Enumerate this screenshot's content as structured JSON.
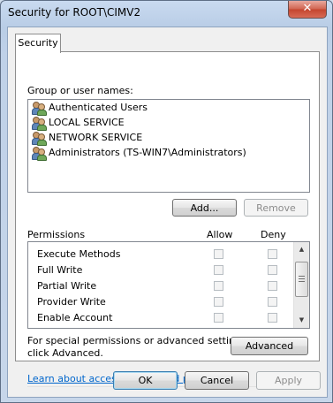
{
  "window": {
    "title": "Security for ROOT\\CIMV2",
    "close_glyph": "✕"
  },
  "tabs": [
    {
      "label": "Security"
    }
  ],
  "group_section": {
    "label": "Group or user names:"
  },
  "users": [
    {
      "name": "Authenticated Users",
      "icon": "user-group-icon"
    },
    {
      "name": "LOCAL SERVICE",
      "icon": "user-group-icon"
    },
    {
      "name": "NETWORK SERVICE",
      "icon": "user-group-icon"
    },
    {
      "name": "Administrators (TS-WIN7\\Administrators)",
      "icon": "user-group-icon"
    }
  ],
  "buttons": {
    "add": "Add...",
    "remove": "Remove",
    "advanced": "Advanced",
    "ok": "OK",
    "cancel": "Cancel",
    "apply": "Apply"
  },
  "permissions": {
    "header": "Permissions",
    "allow_header": "Allow",
    "deny_header": "Deny",
    "items": [
      {
        "name": "Execute Methods",
        "allow": false,
        "deny": false
      },
      {
        "name": "Full Write",
        "allow": false,
        "deny": false
      },
      {
        "name": "Partial Write",
        "allow": false,
        "deny": false
      },
      {
        "name": "Provider Write",
        "allow": false,
        "deny": false
      },
      {
        "name": "Enable Account",
        "allow": false,
        "deny": false
      }
    ]
  },
  "advanced_note": {
    "line1": "For special permissions or advanced settings,",
    "line2": "click Advanced."
  },
  "help_link": "Learn about access control and permissions"
}
